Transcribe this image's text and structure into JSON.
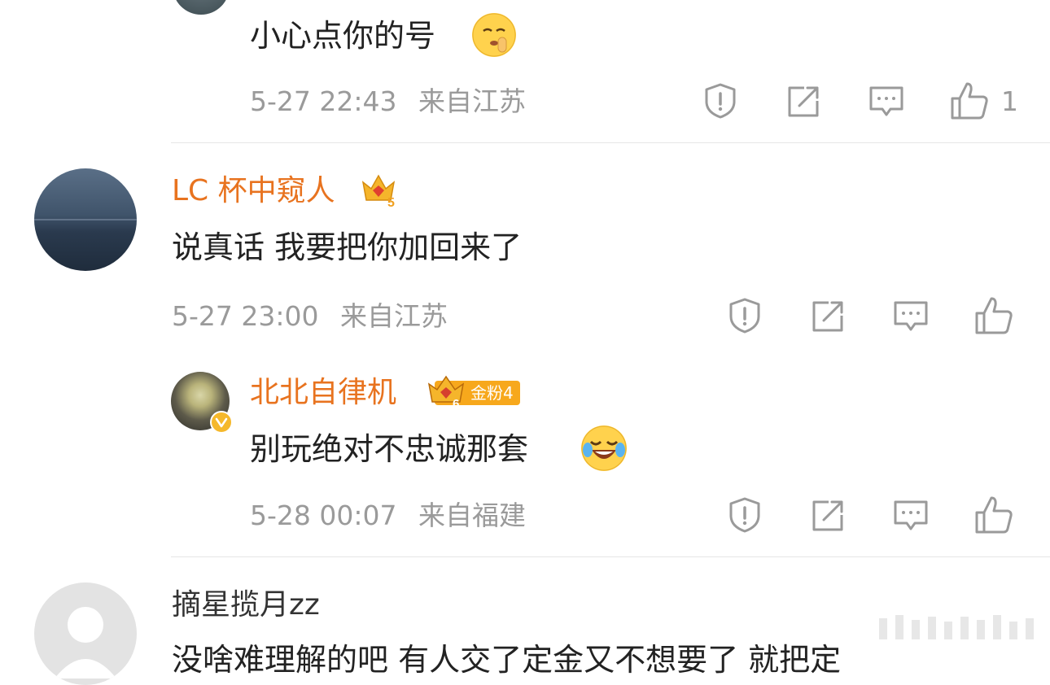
{
  "comments": [
    {
      "text": "小心点你的号",
      "emoji": "shushing-face-emoji",
      "time": "5-27 22:43",
      "location": "来自江苏",
      "like_count": "1"
    },
    {
      "user": "LC 杯中窥人",
      "level_badge": "5",
      "text": "说真话 我要把你加回来了",
      "time": "5-27 23:00",
      "location": "来自江苏",
      "reply": {
        "user": "北北自律机",
        "level_badge": "6",
        "fan_badge": "金粉4",
        "text": "别玩绝对不忠诚那套",
        "emoji": "laughing-crying-emoji",
        "time": "5-28 00:07",
        "location": "来自福建"
      }
    },
    {
      "user": "摘星揽月zz",
      "text_partial": "没啥难理解的吧   有人交了定金又不想要了   就把定"
    }
  ],
  "colors": {
    "username": "#e8731f",
    "meta": "#9a9a9a",
    "icon": "#9a9a9a",
    "divider": "#e6e6e6",
    "badge_gold": "#f7a81c"
  }
}
